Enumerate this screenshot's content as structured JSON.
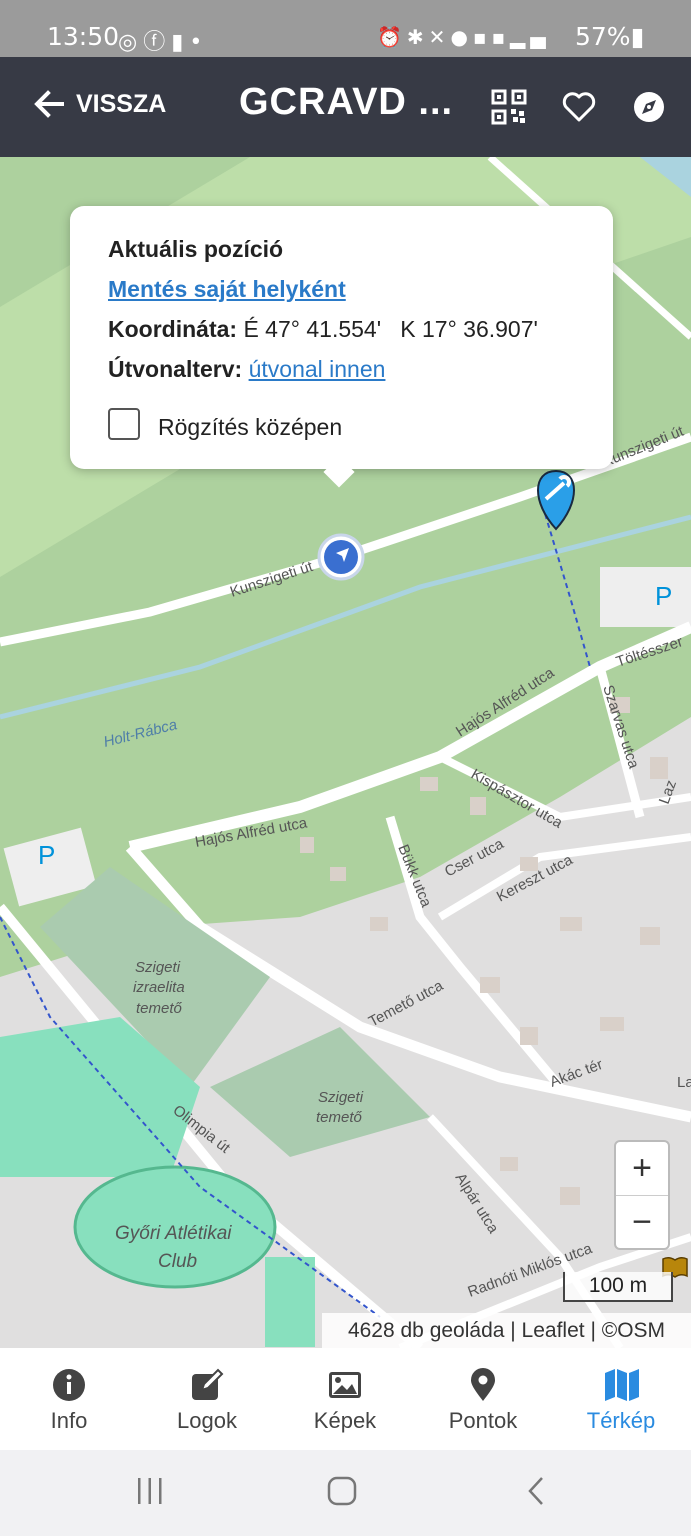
{
  "status_bar": {
    "time": "13:50",
    "left_icons": [
      "instagram-icon",
      "facebook-icon",
      "sd-card-icon",
      "dot-icon"
    ],
    "right_icons": [
      "alarm-icon",
      "bluetooth-icon",
      "mute-icon",
      "location-icon",
      "volte-icon",
      "5g-icon",
      "signal-icon"
    ],
    "battery": "57%"
  },
  "app_bar": {
    "back_label": "VISSZA",
    "title": "GCRAVD ...",
    "actions": [
      "qr-code-icon",
      "heart-icon",
      "compass-icon"
    ]
  },
  "popup": {
    "heading": "Aktuális pozíció",
    "save_link": "Mentés saját helyként",
    "coord_label": "Koordináta:",
    "coord_value": "É 47° 41.554'   K 17° 36.907'",
    "route_label": "Útvonalterv:",
    "route_link": "útvonal innen",
    "checkbox_label": "Rögzítés középen",
    "checkbox_checked": false
  },
  "map": {
    "labels": {
      "kunszigeti": "Kunszigeti út",
      "kunszigeti2": "Kunszigeti út",
      "holt_rabca": "Holt-Rábca",
      "hajos1": "Hajós Alfréd utca",
      "hajos2": "Hajós Alfréd utca",
      "toltesszer": "Töltésszer",
      "szarvas": "Szarvas utca",
      "kispasztor": "Kispásztor utca",
      "bukk": "Bükk utca",
      "cser": "Cser utca",
      "kereszt": "Kereszt utca",
      "temeto_utca": "Temető utca",
      "akac": "Akác tér",
      "olimpia": "Olimpia út",
      "alpar": "Alpár utca",
      "radnoti": "Radnóti Miklós utca",
      "izraelita_1": "Szigeti",
      "izraelita_2": "izraelita",
      "izraelita_3": "temető",
      "szigeti_temeto_1": "Szigeti",
      "szigeti_temeto_2": "temető",
      "club_1": "Győri Atlétikai",
      "club_2": "Club",
      "parking": "P",
      "laz": "Laz",
      "la": "La"
    },
    "zoom_in": "+",
    "zoom_out": "−",
    "scale": "100 m",
    "attribution": "4628 db geoláda | Leaflet | ©OSM"
  },
  "bottom_nav": [
    {
      "label": "Info",
      "icon": "info-icon"
    },
    {
      "label": "Logok",
      "icon": "edit-icon"
    },
    {
      "label": "Képek",
      "icon": "image-icon"
    },
    {
      "label": "Pontok",
      "icon": "map-pin-icon"
    },
    {
      "label": "Térkép",
      "icon": "map-icon",
      "active": true
    }
  ],
  "colors": {
    "app_bar": "#373a45",
    "accent": "#2a8be0",
    "forest": "#add19e",
    "residential": "#e0dfdf",
    "cemetery": "#aacbaf",
    "sports": "#88e0be",
    "water": "#aad3df"
  }
}
